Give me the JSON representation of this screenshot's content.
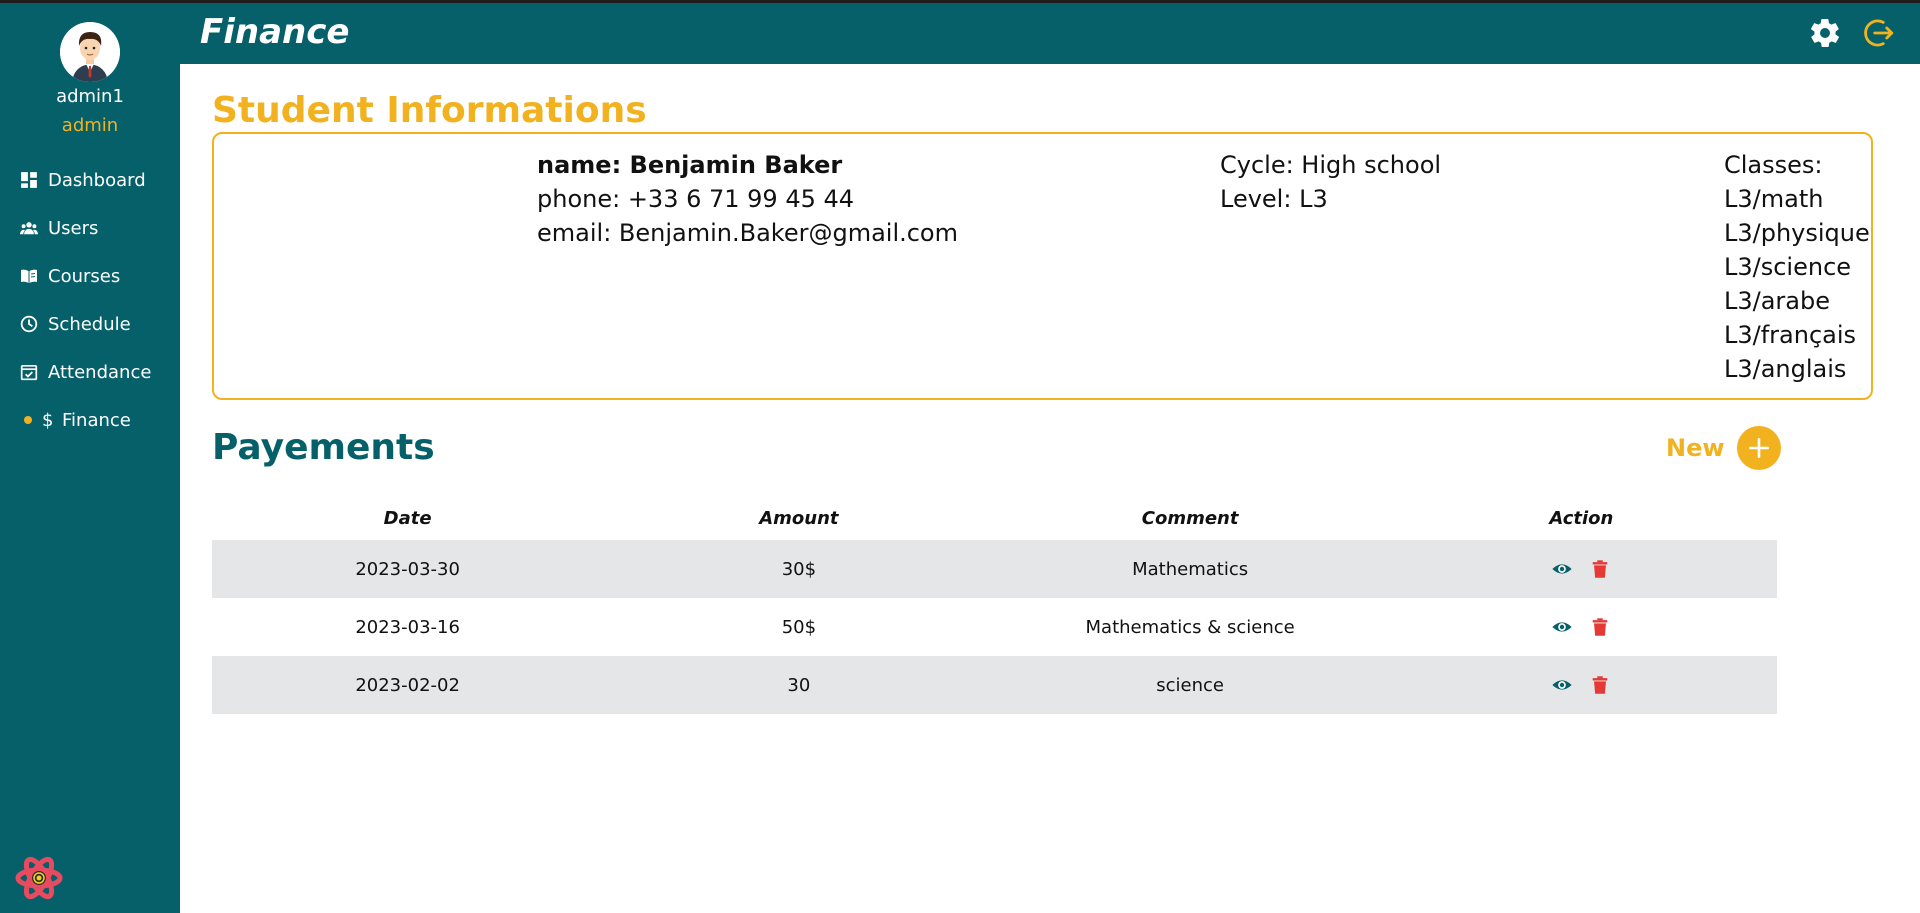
{
  "sidebar": {
    "user": {
      "name": "admin1",
      "role": "admin"
    },
    "items": [
      {
        "label": "Dashboard",
        "icon": "dashboard-icon"
      },
      {
        "label": "Users",
        "icon": "users-icon"
      },
      {
        "label": "Courses",
        "icon": "book-icon"
      },
      {
        "label": "Schedule",
        "icon": "clock-icon"
      },
      {
        "label": "Attendance",
        "icon": "calendar-check-icon"
      },
      {
        "label": "Finance",
        "icon": "dollar-icon",
        "active": true
      }
    ]
  },
  "header": {
    "title": "Finance"
  },
  "student": {
    "section_title": "Student Informations",
    "name_text": "name: Benjamin Baker",
    "phone_text": "phone: +33 6 71 99 45 44",
    "email_text": "email: Benjamin.Baker@gmail.com",
    "cycle_text": "Cycle: High school",
    "level_text": "Level: L3",
    "classes_label": "Classes:",
    "classes": [
      "L3/math",
      "L3/physique",
      "L3/science",
      "L3/arabe",
      "L3/français",
      "L3/anglais"
    ]
  },
  "payments": {
    "section_title": "Payements",
    "new_label": "New",
    "columns": [
      "Date",
      "Amount",
      "Comment",
      "Action"
    ],
    "rows": [
      {
        "date": "2023-03-30",
        "amount": "30$",
        "comment": "Mathematics"
      },
      {
        "date": "2023-03-16",
        "amount": "50$",
        "comment": "Mathematics & science"
      },
      {
        "date": "2023-02-02",
        "amount": "30",
        "comment": "science"
      }
    ]
  },
  "colors": {
    "primary": "#05606a",
    "accent": "#f2b21f",
    "danger": "#e53935",
    "row_alt": "#e5e6e8"
  }
}
